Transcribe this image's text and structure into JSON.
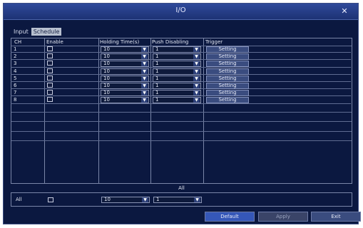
{
  "window": {
    "title": "I/O",
    "close_icon": "close-icon"
  },
  "tabs": [
    {
      "label": "Input",
      "active": false
    },
    {
      "label": "Schedule",
      "active": true
    }
  ],
  "columns": {
    "ch": "CH",
    "enable": "Enable",
    "holding_time": "Holding Time(s)",
    "push_disabling": "Push Disabling",
    "trigger": "Trigger"
  },
  "rows": [
    {
      "ch": "1",
      "holding_time": "10",
      "push_disabling": "1",
      "trigger": "Setting"
    },
    {
      "ch": "2",
      "holding_time": "10",
      "push_disabling": "1",
      "trigger": "Setting"
    },
    {
      "ch": "3",
      "holding_time": "10",
      "push_disabling": "1",
      "trigger": "Setting"
    },
    {
      "ch": "4",
      "holding_time": "10",
      "push_disabling": "1",
      "trigger": "Setting"
    },
    {
      "ch": "5",
      "holding_time": "10",
      "push_disabling": "1",
      "trigger": "Setting"
    },
    {
      "ch": "6",
      "holding_time": "10",
      "push_disabling": "1",
      "trigger": "Setting"
    },
    {
      "ch": "7",
      "holding_time": "10",
      "push_disabling": "1",
      "trigger": "Setting"
    },
    {
      "ch": "8",
      "holding_time": "10",
      "push_disabling": "1",
      "trigger": "Setting"
    }
  ],
  "all": {
    "label": "All",
    "ch": "All",
    "holding_time": "10",
    "push_disabling": "1"
  },
  "footer": {
    "default": "Default",
    "apply": "Apply",
    "exit": "Exit"
  },
  "colors": {
    "window_bg": "#0b1840",
    "titlebar": "#2f4a9a",
    "button": "#3a4c7f",
    "default_button": "#3557b8"
  }
}
